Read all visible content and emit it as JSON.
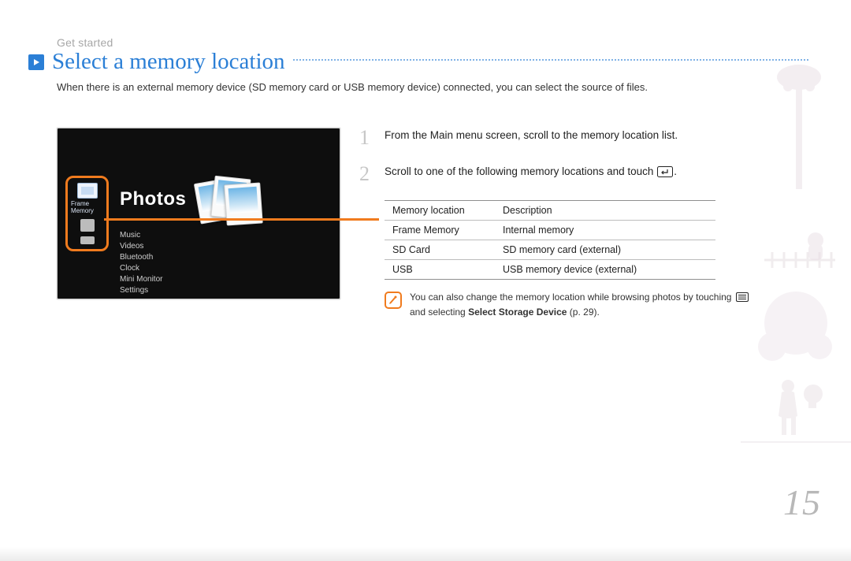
{
  "breadcrumb": "Get started",
  "title": "Select a memory location",
  "intro": "When there is an external memory device (SD memory card or USB memory device) connected, you can select the source of files.",
  "device": {
    "selected_storage_label": "Frame Memory",
    "selected_section": "Photos",
    "menu": [
      "Music",
      "Videos",
      "Bluetooth",
      "Clock",
      "Mini Monitor",
      "Settings"
    ]
  },
  "steps": [
    {
      "num": "1",
      "text": "From the Main menu screen, scroll to the memory location list."
    },
    {
      "num": "2",
      "text_a": "Scroll to one of the following memory locations and touch ",
      "text_b": "."
    }
  ],
  "table": {
    "headers": [
      "Memory location",
      "Description"
    ],
    "rows": [
      [
        "Frame Memory",
        "Internal memory"
      ],
      [
        "SD Card",
        "SD memory card (external)"
      ],
      [
        "USB",
        "USB memory device (external)"
      ]
    ]
  },
  "note": {
    "text_a": "You can also change the memory location while browsing photos by touching ",
    "text_b": " and selecting ",
    "bold": "Select Storage Device",
    "text_c": " (p. ",
    "page_ref": "29",
    "text_d": ")."
  },
  "page_number": "15"
}
